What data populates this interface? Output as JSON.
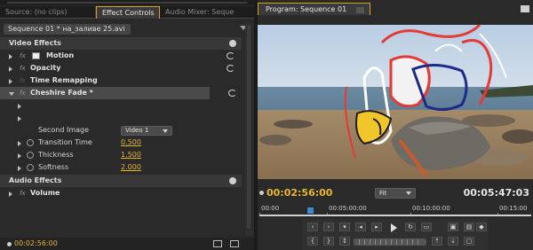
{
  "tabs": {
    "source": "Source: (no clips)",
    "effect_controls": "Effect Controls",
    "audio_mixer": "Audio Mixer: Seque"
  },
  "effect_controls": {
    "sequence_chip": "Sequence 01 * на_заливе 25.avi",
    "fx_symbol": "fx",
    "video_effects_header": "Video Effects",
    "effects": [
      {
        "name": "Motion"
      },
      {
        "name": "Opacity"
      },
      {
        "name": "Time Remapping"
      },
      {
        "name": "Cheshire Fade *"
      }
    ],
    "second_image_label": "Second Image",
    "second_image_value": "Video 1",
    "params": [
      {
        "name": "Transition Time",
        "value": "0.500"
      },
      {
        "name": "Thickness",
        "value": "1.500"
      },
      {
        "name": "Softness",
        "value": "2.000"
      }
    ],
    "audio_effects_header": "Audio Effects",
    "audio_effect": "Volume",
    "timecode": "00:02:56:00"
  },
  "program": {
    "tab_label": "Program: Sequence 01",
    "current_timecode": "00:02:56:00",
    "zoom": "Fit",
    "duration": "00:05:47:03",
    "ruler_labels": [
      "00:00",
      "00:05:00:00",
      "00:10:00:00",
      "00:15:00"
    ],
    "playhead_fraction": 0.18
  }
}
